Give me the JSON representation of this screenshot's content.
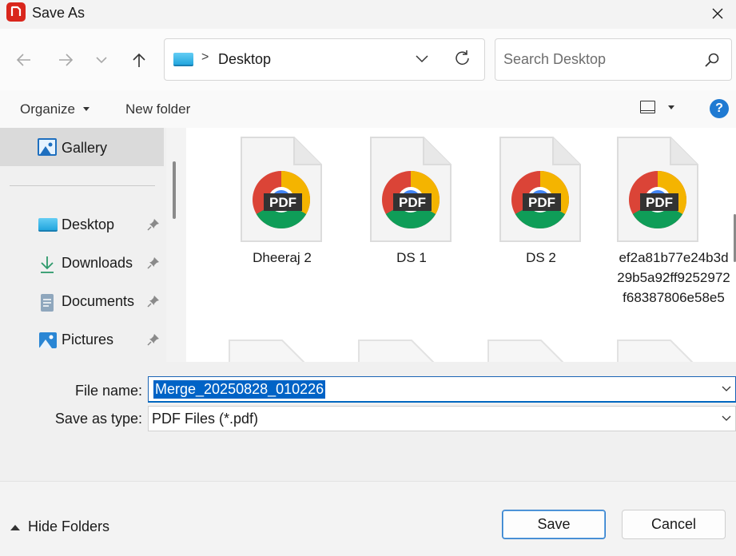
{
  "window": {
    "title": "Save As",
    "app_icon": "pdf-app-icon",
    "close_icon": "close-icon"
  },
  "navigation": {
    "back_icon": "arrow-left-icon",
    "forward_icon": "arrow-right-icon",
    "recent_icon": "chevron-down-icon",
    "up_icon": "arrow-up-icon",
    "address": {
      "icon": "desktop-folder-icon",
      "separator": ">",
      "location": "Desktop"
    },
    "refresh_icon": "refresh-icon",
    "search": {
      "placeholder": "Search Desktop",
      "icon": "search-icon"
    }
  },
  "commandbar": {
    "organize_label": "Organize",
    "new_folder_label": "New folder",
    "help_label": "?"
  },
  "sidebar": {
    "gallery": {
      "label": "Gallery",
      "icon": "gallery-icon"
    },
    "items": [
      {
        "label": "Desktop",
        "icon": "desktop-folder-icon",
        "pinned": true
      },
      {
        "label": "Downloads",
        "icon": "download-icon",
        "pinned": true
      },
      {
        "label": "Documents",
        "icon": "document-icon",
        "pinned": true
      },
      {
        "label": "Pictures",
        "icon": "pictures-icon",
        "pinned": true
      }
    ]
  },
  "files": [
    {
      "name": "Dheeraj 2",
      "type": "PDF",
      "badge": "PDF"
    },
    {
      "name": "DS 1",
      "type": "PDF",
      "badge": "PDF"
    },
    {
      "name": "DS 2",
      "type": "PDF",
      "badge": "PDF"
    },
    {
      "name": "ef2a81b77e24b3d29b5a92ff9252972f68387806e58e5",
      "type": "PDF",
      "badge": "PDF"
    }
  ],
  "form": {
    "file_name_label": "File name:",
    "file_name_value": "Merge_20250828_010226",
    "save_type_label": "Save as type:",
    "save_type_value": "PDF Files (*.pdf)"
  },
  "footer": {
    "hide_folders_label": "Hide Folders",
    "save_label": "Save",
    "cancel_label": "Cancel"
  },
  "colors": {
    "accent": "#0067c0",
    "selection": "#0063c6",
    "app_red": "#d9261c"
  }
}
